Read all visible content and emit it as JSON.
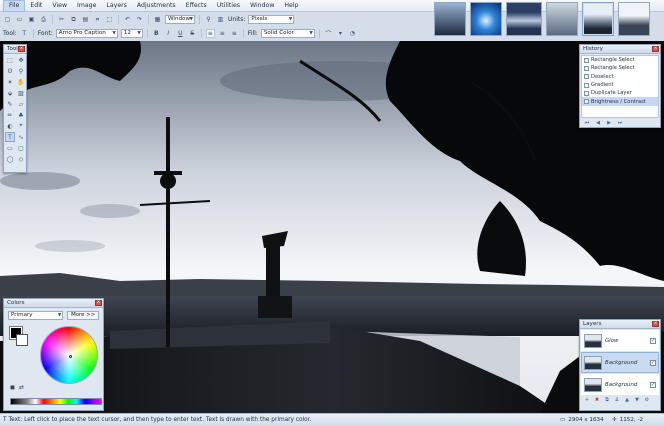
{
  "menu": [
    "File",
    "Edit",
    "View",
    "Image",
    "Layers",
    "Adjustments",
    "Effects",
    "Utilities",
    "Window",
    "Help"
  ],
  "toolbar1": {
    "window_combo": "Window",
    "units_label": "Units:",
    "units_value": "Pixels"
  },
  "toolbar2": {
    "tool_label": "Tool:",
    "font_label": "Font:",
    "font_value": "Arno Pro Caption",
    "size_value": "12",
    "bold": "B",
    "italic": "I",
    "underline": "U",
    "strike": "S",
    "fill_label": "Fill:",
    "fill_value": "Solid Color"
  },
  "panels": {
    "tools_title": "Tools",
    "history_title": "History",
    "colors_title": "Colors",
    "layers_title": "Layers"
  },
  "history": {
    "items": [
      "Rectangle Select",
      "Rectangle Select",
      "Deselect",
      "Gradient",
      "Duplicate Layer",
      "Brightness / Contrast"
    ]
  },
  "colors": {
    "mode": "Primary",
    "more_label": "More >>"
  },
  "layers": [
    {
      "name": "Glow",
      "visible": true,
      "selected": false
    },
    {
      "name": "Background",
      "visible": true,
      "selected": true
    },
    {
      "name": "Background",
      "visible": true,
      "selected": false
    }
  ],
  "status": {
    "message": "Text: Left click to place the text cursor, and then type to enter text. Text is drawn with the primary color.",
    "image_size": "2904 x 1634",
    "cursor_pos": "1152, -2"
  },
  "icons": {
    "close": "close-icon",
    "check": "✓"
  }
}
